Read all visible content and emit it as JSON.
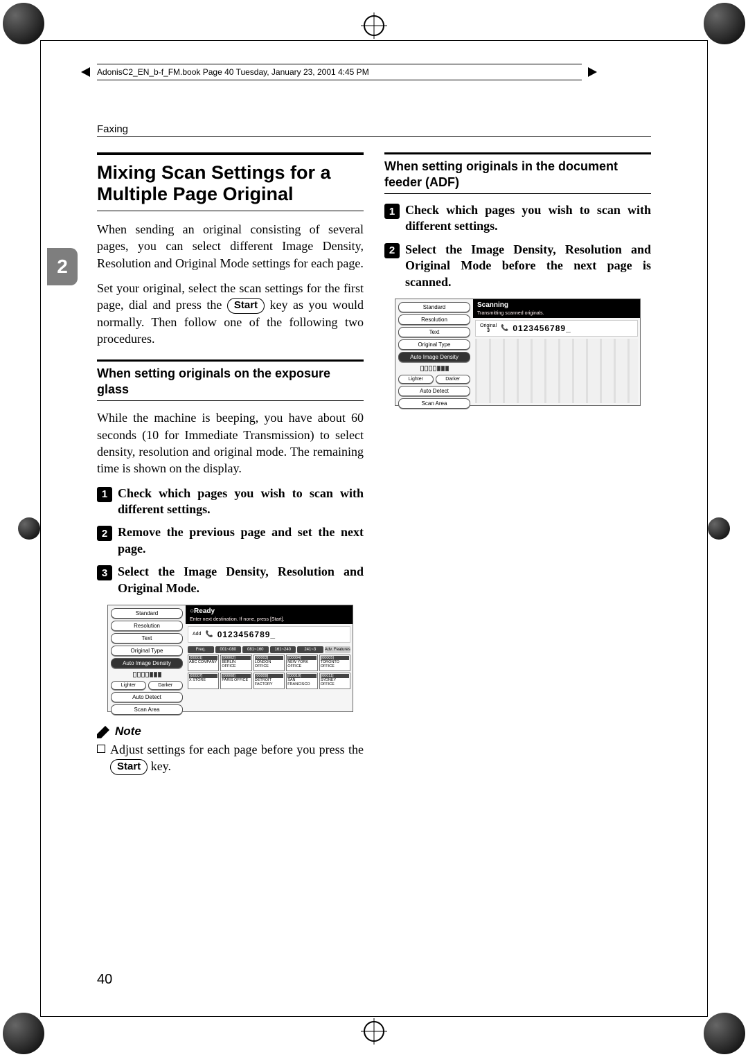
{
  "running_head": "AdonisC2_EN_b-f_FM.book  Page 40  Tuesday, January 23, 2001  4:45 PM",
  "section_label": "Faxing",
  "side_tab": "2",
  "page_number": "40",
  "left": {
    "heading": "Mixing Scan Settings for a Multiple Page Original",
    "para1_a": "When sending an original consisting of several pages, you can select different Image Density, Resolution and Original Mode settings for each page.",
    "para2_a": "Set your original, select the scan settings for the first page, dial and press the ",
    "para2_key": "Start",
    "para2_b": " key as you would normally. Then follow one of the following two procedures.",
    "sub1": "When setting originals on the exposure glass",
    "para3": "While the machine is beeping, you have about 60 seconds (10 for Immediate Transmission) to select density, resolution and original mode. The remaining time is shown on the display.",
    "steps": [
      {
        "n": "1",
        "t": "Check which pages you wish to scan with different settings."
      },
      {
        "n": "2",
        "t": "Remove the previous page and set the next page."
      },
      {
        "n": "3",
        "t": "Select the Image Density, Resolution and Original Mode."
      }
    ],
    "note_label": "Note",
    "note_a": "Adjust settings for each page before you press the ",
    "note_key": "Start",
    "note_b": " key."
  },
  "right": {
    "sub": "When setting originals in the document feeder (ADF)",
    "steps": [
      {
        "n": "1",
        "t": "Check which pages you wish to scan with different settings."
      },
      {
        "n": "2",
        "t": "Select the Image Density, Resolution and Original Mode before the next page is scanned."
      }
    ]
  },
  "shot1": {
    "left_buttons": [
      "Standard",
      "Resolution",
      "Text",
      "Original Type"
    ],
    "density_btn": "Auto Image Density",
    "lighter": "Lighter",
    "darker": "Darker",
    "auto_detect": "Auto Detect",
    "scan_area": "Scan Area",
    "title": "Ready",
    "subtitle": "Enter next destination. If none, press [Start].",
    "add": "Add",
    "number": "0123456789_",
    "tabs": [
      "Freq.",
      "001~080",
      "081~160",
      "161~240",
      "241~3"
    ],
    "adv": "Adv. Features",
    "cells_row1": [
      {
        "h": "[00001]",
        "t": "ABC COMPANY"
      },
      {
        "h": "[00002]",
        "t": "BERLIN OFFICE"
      },
      {
        "h": "[00003]",
        "t": "LONDON OFFICE"
      },
      {
        "h": "[00004]",
        "t": "NEW YORK OFFICE"
      },
      {
        "h": "[00005]",
        "t": "TORONTO OFFICE"
      }
    ],
    "cells_row2": [
      {
        "h": "[00007]",
        "t": "X STORE"
      },
      {
        "h": "[00008]",
        "t": "PARIS OFFICE"
      },
      {
        "h": "[00009]",
        "t": "DETROIT FACTORY"
      },
      {
        "h": "[00010]",
        "t": "SAN FRANCISCO"
      },
      {
        "h": "[00011]",
        "t": "SYDNEY OFFICE"
      }
    ]
  },
  "shot2": {
    "left_buttons": [
      "Standard",
      "Resolution",
      "Text",
      "Original Type"
    ],
    "density_btn": "Auto Image Density",
    "lighter": "Lighter",
    "darker": "Darker",
    "auto_detect": "Auto Detect",
    "scan_area": "Scan Area",
    "title": "Scanning",
    "subtitle": "Transmitting scanned originals.",
    "orig_label": "Original",
    "orig_count": "3",
    "number": "0123456789_"
  }
}
